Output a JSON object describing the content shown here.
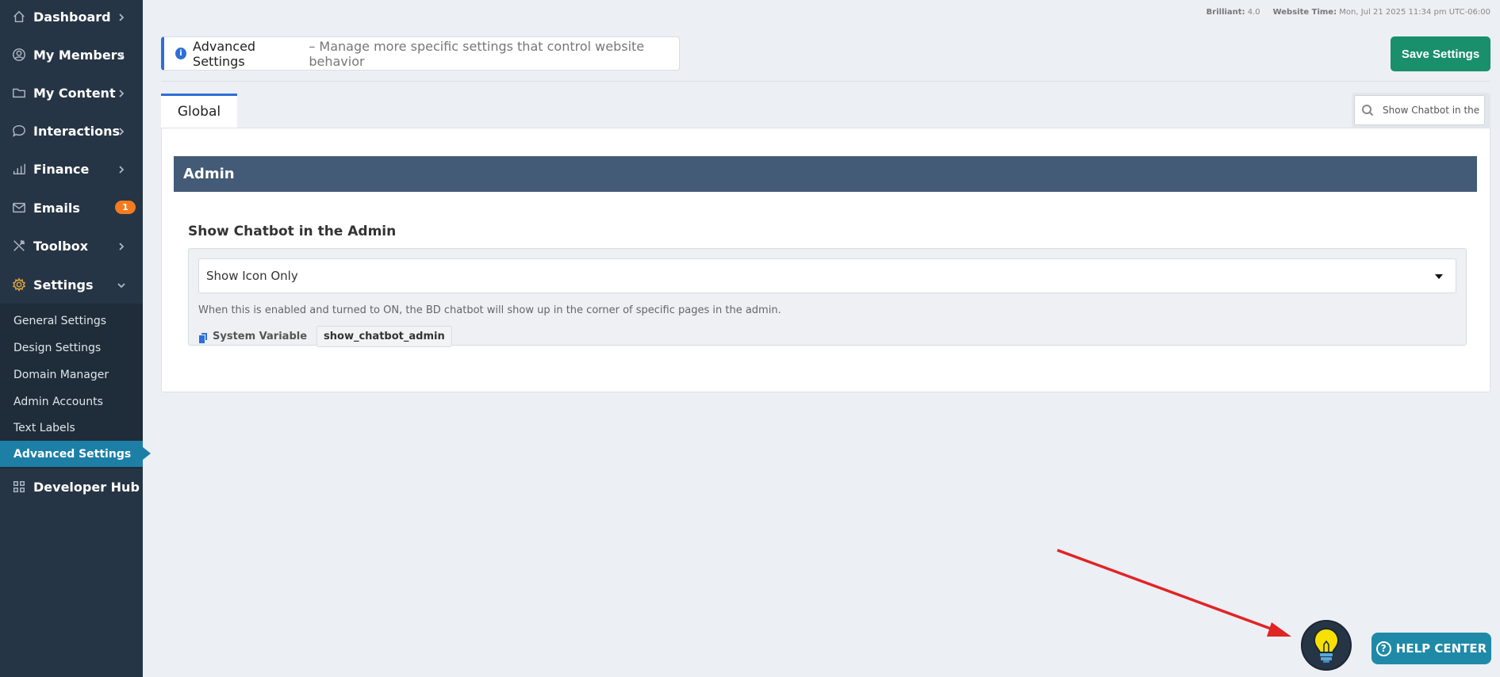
{
  "sidebar": {
    "items": [
      {
        "label": "Dashboard",
        "icon": "home-icon"
      },
      {
        "label": "My Members",
        "icon": "user-circle-icon"
      },
      {
        "label": "My Content",
        "icon": "folder-icon"
      },
      {
        "label": "Interactions",
        "icon": "chat-icon"
      },
      {
        "label": "Finance",
        "icon": "bar-chart-icon"
      },
      {
        "label": "Emails",
        "icon": "mail-icon",
        "badge": "1"
      },
      {
        "label": "Toolbox",
        "icon": "tools-icon"
      },
      {
        "label": "Settings",
        "icon": "gear-icon"
      },
      {
        "label": "Developer Hub",
        "icon": "grid-icon"
      }
    ],
    "subitems": [
      {
        "label": "General Settings"
      },
      {
        "label": "Design Settings"
      },
      {
        "label": "Domain Manager"
      },
      {
        "label": "Admin Accounts"
      },
      {
        "label": "Text Labels"
      },
      {
        "label": "Advanced Settings"
      }
    ]
  },
  "topbar": {
    "version_label": "Brilliant:",
    "version_value": "4.0",
    "time_label": "Website Time:",
    "time_value": "Mon, Jul 21 2025 11:34 pm UTC-06:00"
  },
  "header": {
    "title": "Advanced Settings",
    "subtitle": "– Manage more specific settings that control website behavior"
  },
  "toolbar": {
    "save_label": "Save Settings"
  },
  "tabs": [
    {
      "label": "Global"
    }
  ],
  "search": {
    "value": "Show Chatbot in the"
  },
  "section": {
    "title": "Admin"
  },
  "field": {
    "title": "Show Chatbot in the Admin",
    "selected": "Show Icon Only",
    "help": "When this is enabled and turned to ON, the BD chatbot will show up in the corner of specific pages in the admin.",
    "sysvar_label": "System Variable",
    "sysvar_value": "show_chatbot_admin"
  },
  "help_center": {
    "label": "HELP CENTER"
  },
  "colors": {
    "sidebar": "#263545",
    "accent": "#2e6fd8",
    "save": "#1a8f6b",
    "section": "#445b77",
    "help": "#1f8aa8",
    "arrow": "#e02424",
    "bulb": "#f7e000"
  }
}
